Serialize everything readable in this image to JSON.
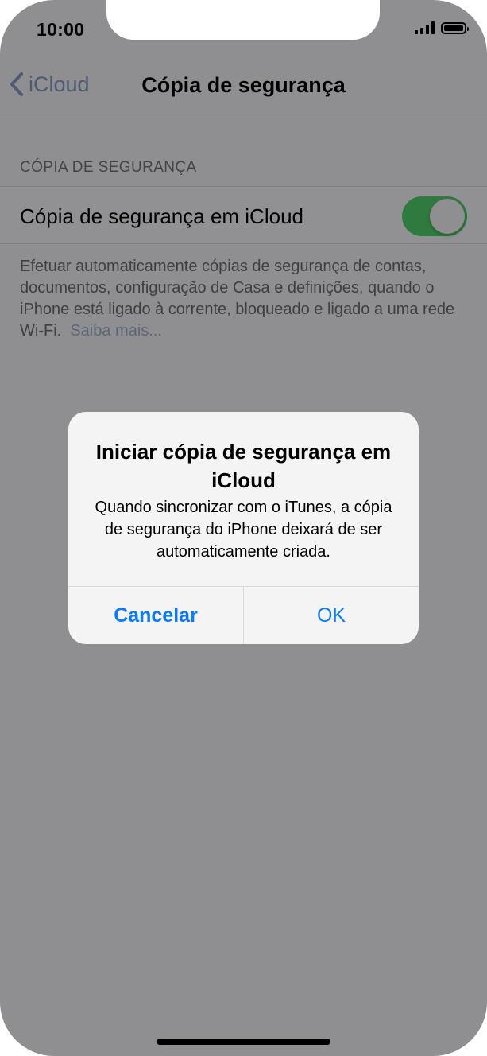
{
  "status_bar": {
    "time": "10:00"
  },
  "nav": {
    "back_label": "iCloud",
    "title": "Cópia de segurança"
  },
  "section": {
    "header": "CÓPIA DE SEGURANÇA",
    "row_label": "Cópia de segurança em iCloud",
    "toggle_on": true,
    "footer": "Efetuar automaticamente cópias de segurança de contas, documentos, configuração de Casa e definições, quando o iPhone está ligado à corrente, bloqueado e ligado a uma rede Wi-Fi.",
    "learn_more": "Saiba mais..."
  },
  "alert": {
    "title": "Iniciar cópia de segurança em iCloud",
    "message": "Quando sincronizar com o iTunes, a cópia de segurança do iPhone deixará de ser automaticamente criada.",
    "cancel_label": "Cancelar",
    "ok_label": "OK"
  },
  "colors": {
    "dim_background": "#8f8f91",
    "toggle_on": "#2f7a3f",
    "alert_button": "#0a7bf4"
  }
}
